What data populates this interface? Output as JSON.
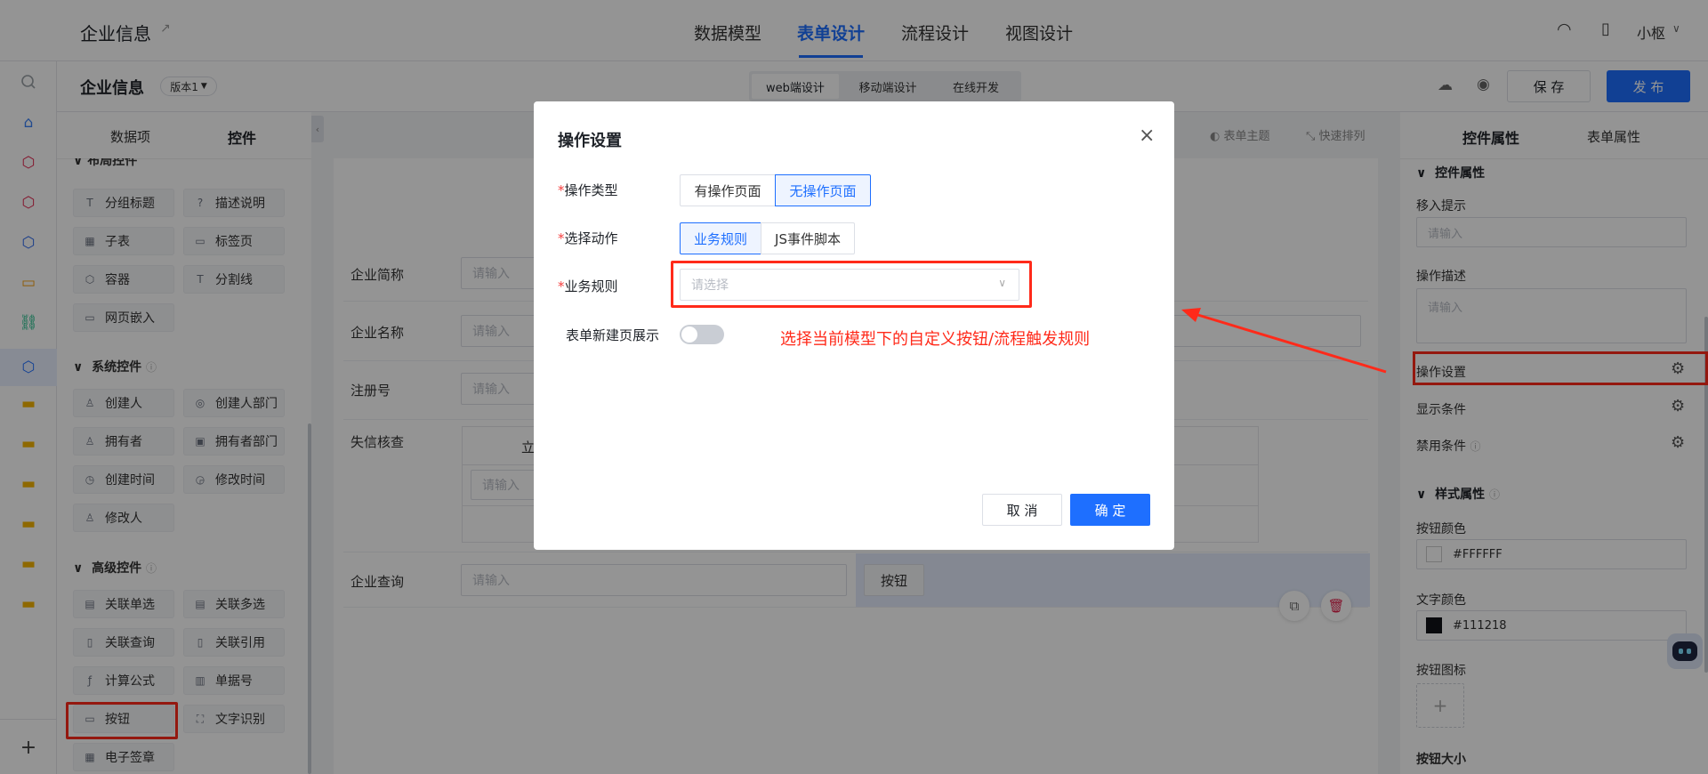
{
  "header": {
    "app_title": "企业信息",
    "tabs": [
      "数据模型",
      "表单设计",
      "流程设计",
      "视图设计"
    ],
    "active_tab": "表单设计",
    "user": "小枢"
  },
  "subheader": {
    "form_title": "企业信息",
    "version": "版本1",
    "modes": [
      "web端设计",
      "移动端设计",
      "在线开发"
    ],
    "save": "保 存",
    "publish": "发 布"
  },
  "left_panel": {
    "tabs": [
      "数据项",
      "控件"
    ],
    "layout_group_partial": "布局控件",
    "layout_controls": [
      "分组标题",
      "描述说明",
      "子表",
      "标签页",
      "容器",
      "分割线",
      "网页嵌入"
    ],
    "system_group": "系统控件",
    "system_controls": [
      "创建人",
      "创建人部门",
      "拥有者",
      "拥有者部门",
      "创建时间",
      "修改时间",
      "修改人"
    ],
    "advanced_group": "高级控件",
    "advanced_controls": [
      "关联单选",
      "关联多选",
      "关联查询",
      "关联引用",
      "计算公式",
      "单据号",
      "按钮",
      "文字识别",
      "电子签章"
    ]
  },
  "canvas": {
    "toolbar": [
      "表单主题",
      "快速排列"
    ],
    "fields": [
      {
        "label": "企业简称",
        "placeholder": "请输入"
      },
      {
        "label": "企业名称",
        "placeholder": "请输入"
      },
      {
        "label": "注册号",
        "placeholder": "请输入"
      },
      {
        "label": "失信核查",
        "placeholder": "请输入"
      },
      {
        "label": "企业查询",
        "placeholder": "请输入"
      }
    ],
    "subtable_header_char": "立",
    "button_label": "按钮"
  },
  "right_panel": {
    "tabs": [
      "控件属性",
      "表单属性"
    ],
    "section_control": "控件属性",
    "hover_tip_label": "移入提示",
    "hover_tip_placeholder": "请输入",
    "desc_label": "操作描述",
    "desc_placeholder": "请输入",
    "op_settings": "操作设置",
    "display_cond": "显示条件",
    "disable_cond": "禁用条件",
    "section_style": "样式属性",
    "btn_color_label": "按钮颜色",
    "btn_color_value": "#FFFFFF",
    "text_color_label": "文字颜色",
    "text_color_value": "#111218",
    "btn_icon_label": "按钮图标",
    "btn_size_label": "按钮大小"
  },
  "modal": {
    "title": "操作设置",
    "op_type_label": "操作类型",
    "op_type_options": [
      "有操作页面",
      "无操作页面"
    ],
    "action_label": "选择动作",
    "action_options": [
      "业务规则",
      "JS事件脚本"
    ],
    "rule_label": "业务规则",
    "rule_placeholder": "请选择",
    "show_on_new_label": "表单新建页展示",
    "cancel": "取 消",
    "confirm": "确 定"
  },
  "annotation": {
    "text": "选择当前模型下的自定义按钮/流程触发规则",
    "color": "#ff2a1a"
  },
  "colors": {
    "primary": "#1e6fff",
    "highlight": "#ff2a1a"
  }
}
